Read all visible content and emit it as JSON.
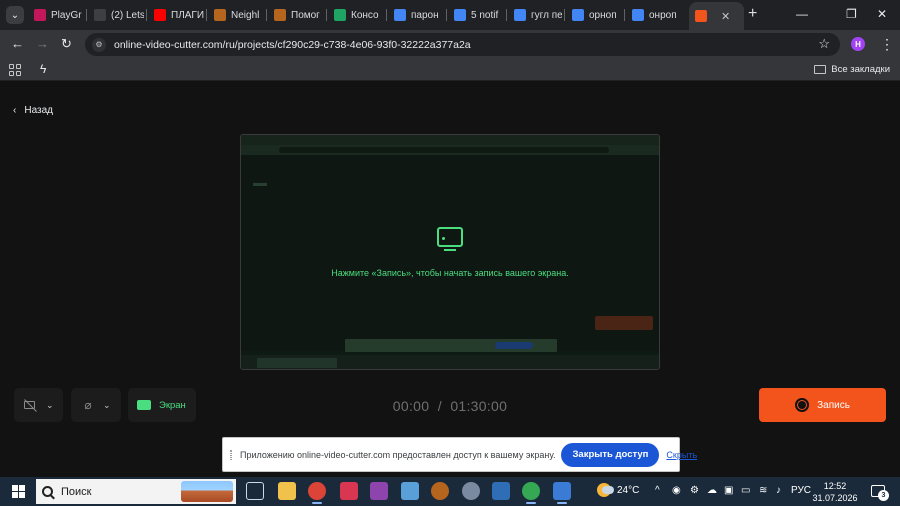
{
  "browser": {
    "tabs": [
      {
        "label": "PlayGr",
        "favicon": "playground-icon",
        "color": "#c2185b"
      },
      {
        "label": "(2) Lets",
        "favicon": "bolt-icon",
        "color": "#3c4043"
      },
      {
        "label": "ПЛАГИ",
        "favicon": "youtube-icon",
        "color": "#ff0000"
      },
      {
        "label": "Neighl",
        "favicon": "person-icon",
        "color": "#b5651d"
      },
      {
        "label": "Помог",
        "favicon": "person-icon",
        "color": "#b5651d"
      },
      {
        "label": "Консо",
        "favicon": "google-drive-icon",
        "color": "#1fa463"
      },
      {
        "label": "парон",
        "favicon": "google-icon",
        "color": "#4285f4"
      },
      {
        "label": "5 notif",
        "favicon": "badge-icon",
        "color": "#4285f4"
      },
      {
        "label": "гугл пе",
        "favicon": "google-icon",
        "color": "#4285f4"
      },
      {
        "label": "орноп",
        "favicon": "google-icon",
        "color": "#4285f4"
      },
      {
        "label": "онроп",
        "favicon": "google-icon",
        "color": "#4285f4"
      },
      {
        "label": "",
        "favicon": "record-icon",
        "color": "#f2541b",
        "active": true
      }
    ],
    "tab_list_glyph": "⌄",
    "new_tab_glyph": "+",
    "window_controls": {
      "minimize": "—",
      "restore": "❐",
      "close": "✕"
    },
    "url": "online-video-cutter.com/ru/projects/cf290c29-c738-4e06-93f0-32222a377a2a",
    "profile_initial": "Н",
    "bookmarks_all_label": "Все закладки",
    "accent_color": "#f2541b"
  },
  "page": {
    "back_label": "Назад",
    "preview_hint": "Нажмите «Запись», чтобы начать запись вашего экрана.",
    "screen_button_label": "Экран",
    "timer_elapsed": "00:00",
    "timer_separator": "/",
    "timer_limit": "01:30:00",
    "record_button_label": "Запись",
    "highlight_color": "#4ade80"
  },
  "share_bar": {
    "message": "Приложению online-video-cutter.com предоставлен доступ к вашему экрану.",
    "stop_label": "Закрыть доступ",
    "hide_label": "Скрыть"
  },
  "taskbar": {
    "search_label": "Поиск",
    "weather_temp": "24°C",
    "language": "РУС",
    "time": "12:52",
    "date": "31.07.2026",
    "notification_count": "3"
  }
}
